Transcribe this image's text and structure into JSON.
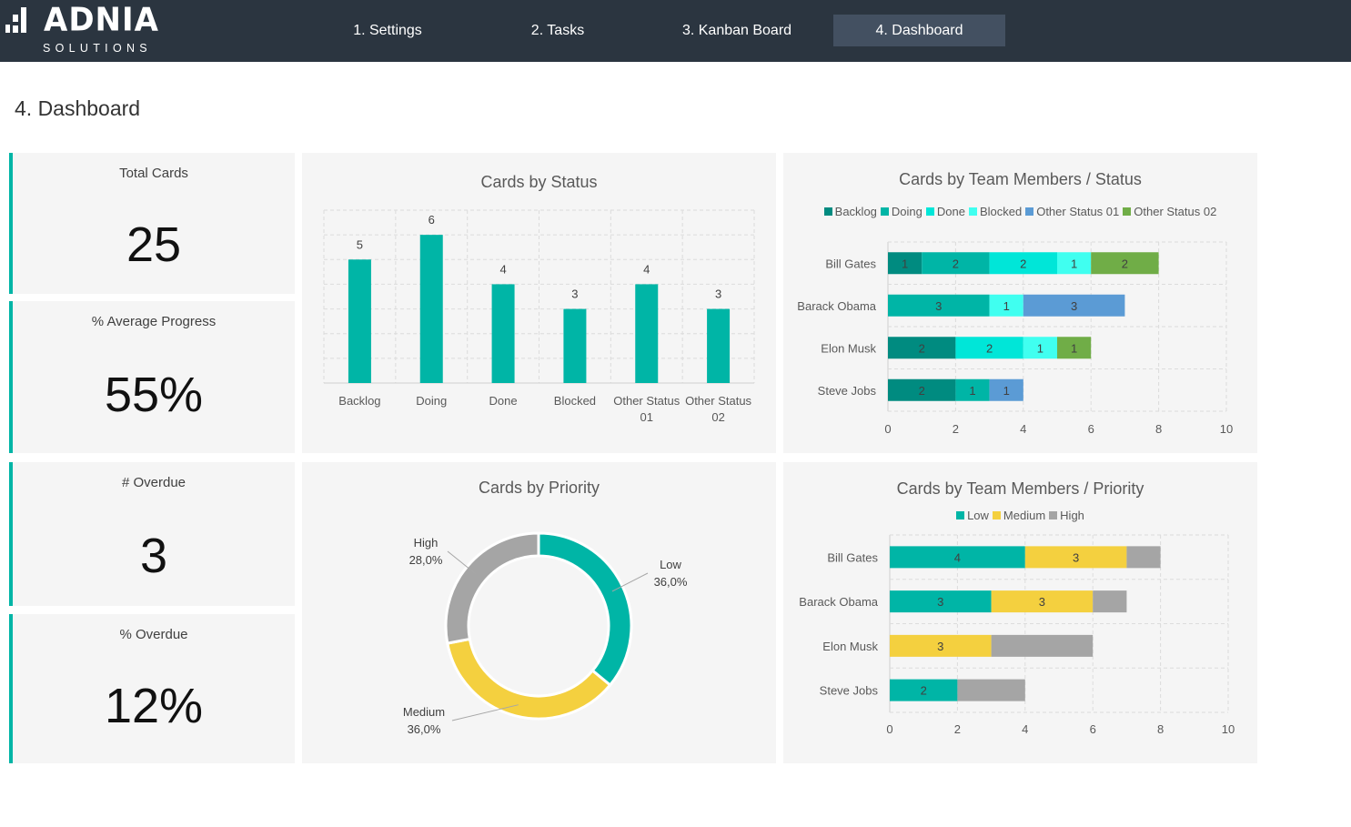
{
  "brand": {
    "name": "ADNIA",
    "tagline": "SOLUTIONS"
  },
  "nav": {
    "tabs": [
      {
        "label": "1. Settings",
        "active": false
      },
      {
        "label": "2. Tasks",
        "active": false
      },
      {
        "label": "3. Kanban Board",
        "active": false
      },
      {
        "label": "4. Dashboard",
        "active": true
      }
    ]
  },
  "page": {
    "title": "4. Dashboard"
  },
  "kpis": [
    {
      "label": "Total Cards",
      "value": "25"
    },
    {
      "label": "% Average Progress",
      "value": "55%"
    },
    {
      "label": "# Overdue",
      "value": "3"
    },
    {
      "label": "% Overdue",
      "value": "12%"
    }
  ],
  "colors": {
    "accent": "#00b5a6",
    "backlog": "#008b80",
    "doing": "#00b5a6",
    "done": "#00e6d8",
    "blocked": "#40fff0",
    "other01": "#5b9bd5",
    "other02": "#70ad47",
    "low": "#00b5a6",
    "medium": "#f4d03f",
    "high": "#a5a5a5"
  },
  "chart_data": [
    {
      "id": "status",
      "type": "bar",
      "title": "Cards by Status",
      "categories": [
        "Backlog",
        "Doing",
        "Done",
        "Blocked",
        "Other Status 01",
        "Other Status 02"
      ],
      "values": [
        5,
        6,
        4,
        3,
        4,
        3
      ],
      "ylim": [
        0,
        7
      ],
      "grid": true,
      "xlabel": "",
      "ylabel": ""
    },
    {
      "id": "team_status",
      "type": "bar",
      "orientation": "horizontal-stacked",
      "title": "Cards by Team Members / Status",
      "categories": [
        "Bill Gates",
        "Barack Obama",
        "Elon Musk",
        "Steve Jobs"
      ],
      "series": [
        {
          "name": "Backlog",
          "color_key": "backlog",
          "values": [
            1,
            0,
            2,
            2
          ]
        },
        {
          "name": "Doing",
          "color_key": "doing",
          "values": [
            2,
            3,
            0,
            1
          ]
        },
        {
          "name": "Done",
          "color_key": "done",
          "values": [
            2,
            0,
            2,
            0
          ]
        },
        {
          "name": "Blocked",
          "color_key": "blocked",
          "values": [
            1,
            1,
            1,
            0
          ]
        },
        {
          "name": "Other Status 01",
          "color_key": "other01",
          "values": [
            0,
            3,
            0,
            1
          ]
        },
        {
          "name": "Other Status 02",
          "color_key": "other02",
          "values": [
            2,
            0,
            1,
            0
          ]
        }
      ],
      "xlim": [
        0,
        10
      ],
      "xticks": [
        0,
        2,
        4,
        6,
        8,
        10
      ],
      "legend": "top",
      "grid": true
    },
    {
      "id": "priority",
      "type": "pie",
      "variant": "donut",
      "title": "Cards by Priority",
      "slices": [
        {
          "name": "Low",
          "value": 36.0,
          "label": "36,0%",
          "color_key": "low"
        },
        {
          "name": "Medium",
          "value": 36.0,
          "label": "36,0%",
          "color_key": "medium"
        },
        {
          "name": "High",
          "value": 28.0,
          "label": "28,0%",
          "color_key": "high"
        }
      ]
    },
    {
      "id": "team_priority",
      "type": "bar",
      "orientation": "horizontal-stacked",
      "title": "Cards by Team Members / Priority",
      "categories": [
        "Bill Gates",
        "Barack Obama",
        "Elon Musk",
        "Steve Jobs"
      ],
      "series": [
        {
          "name": "Low",
          "color_key": "low",
          "values": [
            4,
            3,
            0,
            2
          ],
          "show_labels": true
        },
        {
          "name": "Medium",
          "color_key": "medium",
          "values": [
            3,
            3,
            3,
            0
          ],
          "show_labels": true
        },
        {
          "name": "High",
          "color_key": "high",
          "values": [
            1,
            1,
            3,
            2
          ],
          "show_labels": false
        }
      ],
      "xlim": [
        0,
        10
      ],
      "xticks": [
        0,
        2,
        4,
        6,
        8,
        10
      ],
      "legend": "top",
      "grid": true
    }
  ]
}
